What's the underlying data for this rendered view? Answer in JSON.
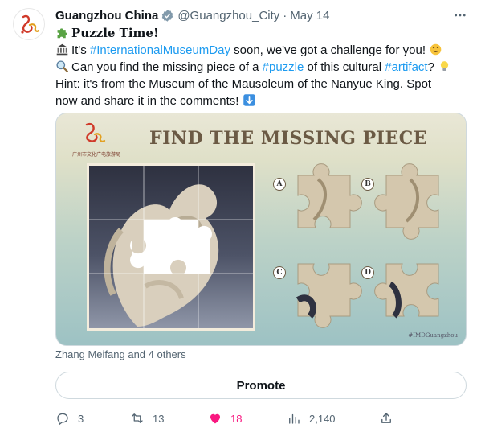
{
  "author": {
    "name": "Guangzhou China",
    "handle": "@Guangzhou_City",
    "separator": "·",
    "date": "May 14"
  },
  "tweet": {
    "title": "Puzzle Time!",
    "line2_prefix": "It's ",
    "line2_hashtag": "#InternationalMuseumDay",
    "line2_suffix": " soon, we've got a challenge for you!",
    "line3_prefix": "Can you find the missing piece of a ",
    "line3_hashtag1": "#puzzle",
    "line3_mid": " of this cultural ",
    "line3_hashtag2": "#artifact",
    "line3_suffix": "?",
    "line4": "Hint: it's from the Museum of the Mausoleum of the Nanyue King. Spot",
    "line5": "now and share it in the comments!"
  },
  "media": {
    "heading": "FIND THE MISSING PIECE",
    "logo_caption": "广州市文化广电旅游局",
    "options": [
      "A",
      "B",
      "C",
      "D"
    ],
    "watermark": "#IMDGuangzhou"
  },
  "liked_by": "Zhang Meifang and 4 others",
  "promote_label": "Promote",
  "actions": {
    "replies": "3",
    "retweets": "13",
    "likes": "18",
    "views": "2,140"
  },
  "colors": {
    "link": "#1d9bf0",
    "like": "#f91880",
    "muted": "#536471",
    "verified": "#829aab"
  },
  "icons": [
    "verified-badge-icon",
    "more-icon",
    "puzzle-emoji-icon",
    "museum-emoji-icon",
    "magnifier-emoji-icon",
    "lightbulb-emoji-icon",
    "arrow-down-emoji-icon",
    "reply-icon",
    "retweet-icon",
    "heart-icon",
    "views-icon",
    "share-icon"
  ]
}
